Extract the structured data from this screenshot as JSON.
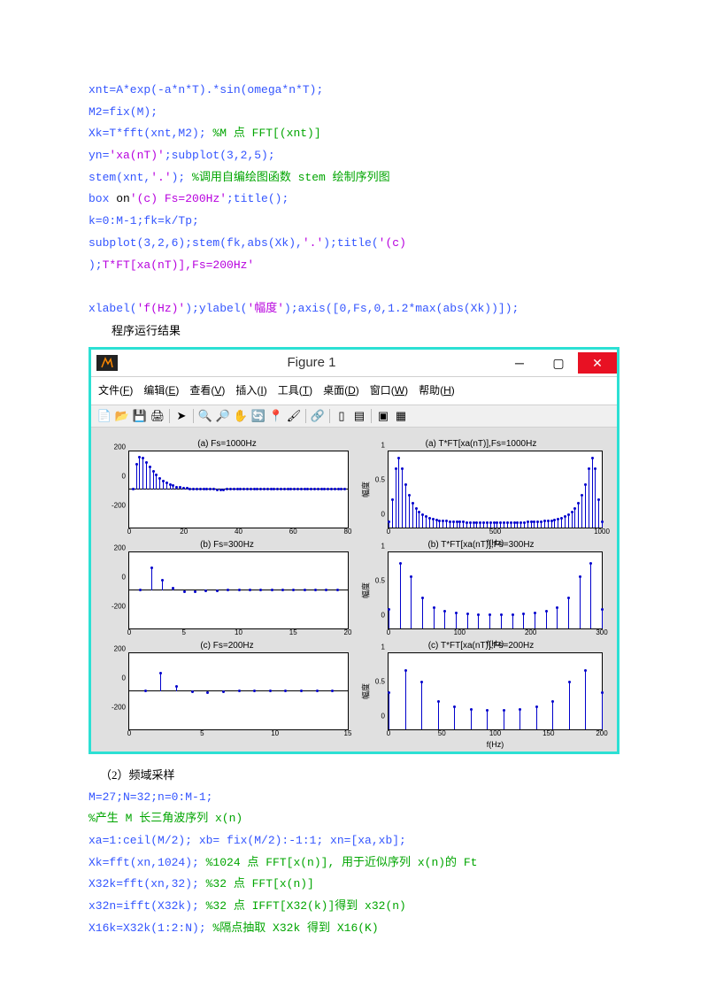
{
  "code_top": [
    {
      "t": "xnt=A*exp(-a*n*T).*sin(omega*n*T);"
    },
    {
      "t": "M2=fix(M);"
    },
    {
      "t": "Xk=T*fft(xnt,M2); ",
      "c": "%M 点 FFT[(xnt)]"
    },
    {
      "t": "yn=",
      "s": "'xa(nT)'",
      "t2": ";subplot(3,2,5);"
    },
    {
      "t": "stem(xnt,",
      "s": "'.'",
      "t2": "); ",
      "c": "%调用自编绘图函数 stem 绘制序列图"
    },
    {
      "t": "box ",
      "b": "on",
      "t2": ";title(",
      "s": "'(c) Fs=200Hz'",
      "t3": ");"
    },
    {
      "t": "k=0:M-1;fk=k/Tp;"
    },
    {
      "t": "subplot(3,2,6);stem(fk,abs(Xk),",
      "s": "'.'",
      "t2": ");title(",
      "s2": "'(c)"
    },
    {
      "s": "T*FT[xa(nT)],Fs=200Hz'",
      "t": ");"
    },
    {
      "t": ""
    },
    {
      "t": "xlabel(",
      "s": "'f(Hz)'",
      "t2": ");ylabel(",
      "s2": "'幅度'",
      "t3": ");axis([0,Fs,0,1.2*max(abs(Xk))]);"
    }
  ],
  "result_label": "程序运行结果",
  "fig": {
    "title": "Figure 1",
    "menus": [
      "文件(F)",
      "编辑(E)",
      "查看(V)",
      "插入(I)",
      "工具(T)",
      "桌面(D)",
      "窗口(W)",
      "帮助(H)"
    ]
  },
  "charts": [
    {
      "title": "(a) Fs=1000Hz",
      "ylabel": "",
      "xlabel": "",
      "xticks": [
        0,
        20,
        40,
        60,
        80
      ],
      "yticks": [
        -200,
        0,
        200
      ],
      "xlim": [
        0,
        80
      ],
      "ylim": [
        -260,
        260
      ],
      "data": [
        0,
        170,
        220,
        210,
        180,
        150,
        120,
        95,
        72,
        56,
        42,
        30,
        22,
        15,
        10,
        7,
        5,
        3,
        2,
        1,
        0,
        0,
        0,
        0,
        0,
        -1,
        -1,
        -1,
        0,
        0,
        0,
        0,
        0,
        0,
        0,
        0,
        0,
        0,
        0,
        0,
        0,
        0,
        0,
        0,
        0,
        0,
        0,
        0,
        0,
        0,
        0,
        0,
        0,
        0,
        0,
        0,
        0,
        0,
        0,
        0,
        0,
        0,
        0,
        0
      ]
    },
    {
      "title": "(a) T*FT[xa(nT)],Fs=1000Hz",
      "ylabel": "幅度",
      "xlabel": "f(Hz)",
      "xticks": [
        0,
        500,
        1000
      ],
      "yticks": [
        0,
        0.5,
        1
      ],
      "xlim": [
        0,
        1000
      ],
      "ylim": [
        0,
        1.1
      ],
      "data": [
        0.08,
        0.4,
        0.85,
        1.0,
        0.85,
        0.62,
        0.46,
        0.35,
        0.27,
        0.22,
        0.18,
        0.15,
        0.13,
        0.115,
        0.1,
        0.095,
        0.09,
        0.085,
        0.08,
        0.078,
        0.076,
        0.074,
        0.072,
        0.071,
        0.07,
        0.07,
        0.07,
        0.07,
        0.07,
        0.07,
        0.07,
        0.07,
        0.07,
        0.07,
        0.07,
        0.07,
        0.07,
        0.07,
        0.07,
        0.07,
        0.071,
        0.072,
        0.074,
        0.076,
        0.078,
        0.08,
        0.085,
        0.09,
        0.095,
        0.1,
        0.115,
        0.13,
        0.15,
        0.18,
        0.22,
        0.27,
        0.35,
        0.46,
        0.62,
        0.85,
        1.0,
        0.85,
        0.4,
        0.08
      ]
    },
    {
      "title": "(b) Fs=300Hz",
      "ylabel": "",
      "xlabel": "",
      "xticks": [
        0,
        5,
        10,
        15,
        20
      ],
      "yticks": [
        -200,
        0,
        200
      ],
      "xlim": [
        0,
        20
      ],
      "ylim": [
        -260,
        260
      ],
      "data": [
        0,
        150,
        65,
        14,
        -4,
        -5,
        -2,
        -1,
        0,
        0,
        0,
        0,
        0,
        0,
        0,
        0,
        0,
        0,
        0
      ]
    },
    {
      "title": "(b) T*FT[xa(nT)],Fs=300Hz",
      "ylabel": "幅度",
      "xlabel": "f(Hz)",
      "xticks": [
        0,
        100,
        200,
        300
      ],
      "yticks": [
        0,
        0.5,
        1
      ],
      "xlim": [
        0,
        300
      ],
      "ylim": [
        0,
        1.1
      ],
      "data": [
        0.27,
        0.94,
        0.74,
        0.43,
        0.3,
        0.24,
        0.22,
        0.2,
        0.19,
        0.19,
        0.19,
        0.19,
        0.2,
        0.22,
        0.24,
        0.3,
        0.43,
        0.74,
        0.94,
        0.27
      ]
    },
    {
      "title": "(c) Fs=200Hz",
      "ylabel": "",
      "xlabel": "",
      "xticks": [
        0,
        5,
        10,
        15
      ],
      "yticks": [
        -200,
        0,
        200
      ],
      "xlim": [
        0,
        15
      ],
      "ylim": [
        -260,
        260
      ],
      "data": [
        0,
        120,
        28,
        -2,
        -4,
        -1,
        0,
        0,
        0,
        0,
        0,
        0,
        0
      ]
    },
    {
      "title": "(c) T*FT[xa(nT)],Fs=200Hz",
      "ylabel": "幅度",
      "xlabel": "f(Hz)",
      "xticks": [
        0,
        50,
        100,
        150,
        200
      ],
      "yticks": [
        0,
        0.5,
        1
      ],
      "xlim": [
        0,
        200
      ],
      "ylim": [
        0,
        1.1
      ],
      "data": [
        0.52,
        0.85,
        0.68,
        0.4,
        0.32,
        0.28,
        0.27,
        0.27,
        0.28,
        0.32,
        0.4,
        0.68,
        0.85,
        0.52
      ]
    }
  ],
  "section2": "（2）频域采样",
  "code_bot": [
    {
      "t": "M=27;N=32;n=0:M-1;"
    },
    {
      "c": "%产生 M 长三角波序列 x(n)"
    },
    {
      "t": "xa=1:ceil(M/2);  xb= fix(M/2):-1:1;  xn=[xa,xb];"
    },
    {
      "t": "Xk=fft(xn,1024);  ",
      "c": "%1024 点 FFT[x(n)], 用于近似序列 x(n)的 Ft"
    },
    {
      "t": "X32k=fft(xn,32); ",
      "c": "%32 点 FFT[x(n)]"
    },
    {
      "t": "x32n=ifft(X32k); ",
      "c": "%32 点 IFFT[X32(k)]得到 x32(n)"
    },
    {
      "t": "X16k=X32k(1:2:N); ",
      "c": "%隔点抽取 X32k 得到 X16(K)"
    }
  ],
  "chart_data": [
    {
      "type": "stem",
      "title": "(a) Fs=1000Hz",
      "x": "index 0..63",
      "ylim": [
        -260,
        260
      ],
      "values": "damped sinusoid xnt at Fs=1000Hz"
    },
    {
      "type": "stem",
      "title": "(a) T*FT[xa(nT)],Fs=1000Hz",
      "xlabel": "f(Hz)",
      "ylabel": "幅度",
      "xlim": [
        0,
        1000
      ],
      "ylim": [
        0,
        1.1
      ],
      "note": "magnitude spectrum, symmetric bathtub"
    },
    {
      "type": "stem",
      "title": "(b) Fs=300Hz",
      "x": "index 0..18",
      "ylim": [
        -260,
        260
      ]
    },
    {
      "type": "stem",
      "title": "(b) T*FT[xa(nT)],Fs=300Hz",
      "xlabel": "f(Hz)",
      "ylabel": "幅度",
      "xlim": [
        0,
        300
      ],
      "ylim": [
        0,
        1.1
      ]
    },
    {
      "type": "stem",
      "title": "(c) Fs=200Hz",
      "x": "index 0..12",
      "ylim": [
        -260,
        260
      ]
    },
    {
      "type": "stem",
      "title": "(c) T*FT[xa(nT)],Fs=200Hz",
      "xlabel": "f(Hz)",
      "ylabel": "幅度",
      "xlim": [
        0,
        200
      ],
      "ylim": [
        0,
        1.1
      ]
    }
  ]
}
